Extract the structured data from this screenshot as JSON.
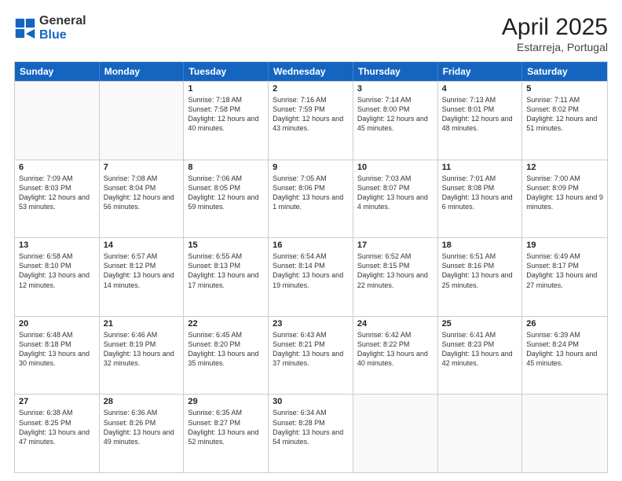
{
  "header": {
    "logo_general": "General",
    "logo_blue": "Blue",
    "month_title": "April 2025",
    "subtitle": "Estarreja, Portugal"
  },
  "days_of_week": [
    "Sunday",
    "Monday",
    "Tuesday",
    "Wednesday",
    "Thursday",
    "Friday",
    "Saturday"
  ],
  "weeks": [
    [
      {
        "day": "",
        "info": ""
      },
      {
        "day": "",
        "info": ""
      },
      {
        "day": "1",
        "info": "Sunrise: 7:18 AM\nSunset: 7:58 PM\nDaylight: 12 hours and 40 minutes."
      },
      {
        "day": "2",
        "info": "Sunrise: 7:16 AM\nSunset: 7:59 PM\nDaylight: 12 hours and 43 minutes."
      },
      {
        "day": "3",
        "info": "Sunrise: 7:14 AM\nSunset: 8:00 PM\nDaylight: 12 hours and 45 minutes."
      },
      {
        "day": "4",
        "info": "Sunrise: 7:13 AM\nSunset: 8:01 PM\nDaylight: 12 hours and 48 minutes."
      },
      {
        "day": "5",
        "info": "Sunrise: 7:11 AM\nSunset: 8:02 PM\nDaylight: 12 hours and 51 minutes."
      }
    ],
    [
      {
        "day": "6",
        "info": "Sunrise: 7:09 AM\nSunset: 8:03 PM\nDaylight: 12 hours and 53 minutes."
      },
      {
        "day": "7",
        "info": "Sunrise: 7:08 AM\nSunset: 8:04 PM\nDaylight: 12 hours and 56 minutes."
      },
      {
        "day": "8",
        "info": "Sunrise: 7:06 AM\nSunset: 8:05 PM\nDaylight: 12 hours and 59 minutes."
      },
      {
        "day": "9",
        "info": "Sunrise: 7:05 AM\nSunset: 8:06 PM\nDaylight: 13 hours and 1 minute."
      },
      {
        "day": "10",
        "info": "Sunrise: 7:03 AM\nSunset: 8:07 PM\nDaylight: 13 hours and 4 minutes."
      },
      {
        "day": "11",
        "info": "Sunrise: 7:01 AM\nSunset: 8:08 PM\nDaylight: 13 hours and 6 minutes."
      },
      {
        "day": "12",
        "info": "Sunrise: 7:00 AM\nSunset: 8:09 PM\nDaylight: 13 hours and 9 minutes."
      }
    ],
    [
      {
        "day": "13",
        "info": "Sunrise: 6:58 AM\nSunset: 8:10 PM\nDaylight: 13 hours and 12 minutes."
      },
      {
        "day": "14",
        "info": "Sunrise: 6:57 AM\nSunset: 8:12 PM\nDaylight: 13 hours and 14 minutes."
      },
      {
        "day": "15",
        "info": "Sunrise: 6:55 AM\nSunset: 8:13 PM\nDaylight: 13 hours and 17 minutes."
      },
      {
        "day": "16",
        "info": "Sunrise: 6:54 AM\nSunset: 8:14 PM\nDaylight: 13 hours and 19 minutes."
      },
      {
        "day": "17",
        "info": "Sunrise: 6:52 AM\nSunset: 8:15 PM\nDaylight: 13 hours and 22 minutes."
      },
      {
        "day": "18",
        "info": "Sunrise: 6:51 AM\nSunset: 8:16 PM\nDaylight: 13 hours and 25 minutes."
      },
      {
        "day": "19",
        "info": "Sunrise: 6:49 AM\nSunset: 8:17 PM\nDaylight: 13 hours and 27 minutes."
      }
    ],
    [
      {
        "day": "20",
        "info": "Sunrise: 6:48 AM\nSunset: 8:18 PM\nDaylight: 13 hours and 30 minutes."
      },
      {
        "day": "21",
        "info": "Sunrise: 6:46 AM\nSunset: 8:19 PM\nDaylight: 13 hours and 32 minutes."
      },
      {
        "day": "22",
        "info": "Sunrise: 6:45 AM\nSunset: 8:20 PM\nDaylight: 13 hours and 35 minutes."
      },
      {
        "day": "23",
        "info": "Sunrise: 6:43 AM\nSunset: 8:21 PM\nDaylight: 13 hours and 37 minutes."
      },
      {
        "day": "24",
        "info": "Sunrise: 6:42 AM\nSunset: 8:22 PM\nDaylight: 13 hours and 40 minutes."
      },
      {
        "day": "25",
        "info": "Sunrise: 6:41 AM\nSunset: 8:23 PM\nDaylight: 13 hours and 42 minutes."
      },
      {
        "day": "26",
        "info": "Sunrise: 6:39 AM\nSunset: 8:24 PM\nDaylight: 13 hours and 45 minutes."
      }
    ],
    [
      {
        "day": "27",
        "info": "Sunrise: 6:38 AM\nSunset: 8:25 PM\nDaylight: 13 hours and 47 minutes."
      },
      {
        "day": "28",
        "info": "Sunrise: 6:36 AM\nSunset: 8:26 PM\nDaylight: 13 hours and 49 minutes."
      },
      {
        "day": "29",
        "info": "Sunrise: 6:35 AM\nSunset: 8:27 PM\nDaylight: 13 hours and 52 minutes."
      },
      {
        "day": "30",
        "info": "Sunrise: 6:34 AM\nSunset: 8:28 PM\nDaylight: 13 hours and 54 minutes."
      },
      {
        "day": "",
        "info": ""
      },
      {
        "day": "",
        "info": ""
      },
      {
        "day": "",
        "info": ""
      }
    ]
  ]
}
